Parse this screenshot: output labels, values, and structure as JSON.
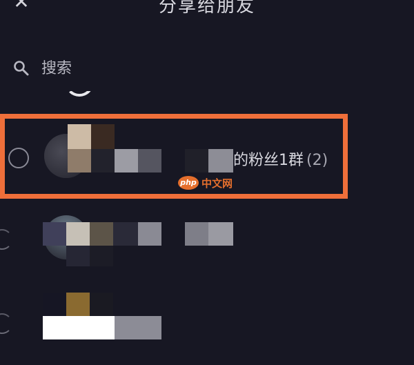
{
  "header": {
    "title": "分享给朋友",
    "close_symbol": "✕"
  },
  "search": {
    "placeholder": "搜索",
    "value": ""
  },
  "contacts": [
    {
      "name": "的粉丝1群",
      "count": "(2)",
      "selected": false,
      "highlighted": true
    },
    {
      "name": "",
      "count": "",
      "selected": false,
      "highlighted": false
    },
    {
      "name": "",
      "count": "",
      "selected": false,
      "highlighted": false
    }
  ],
  "watermark": {
    "logo": "php",
    "text": "中文网"
  },
  "colors": {
    "background": "#171723",
    "highlight": "#ef6f3a",
    "text": "#d8d8df",
    "muted": "#a8a8b2"
  },
  "icons": {
    "close": "close-icon",
    "search": "search-icon",
    "radio": "radio-unchecked-icon"
  }
}
